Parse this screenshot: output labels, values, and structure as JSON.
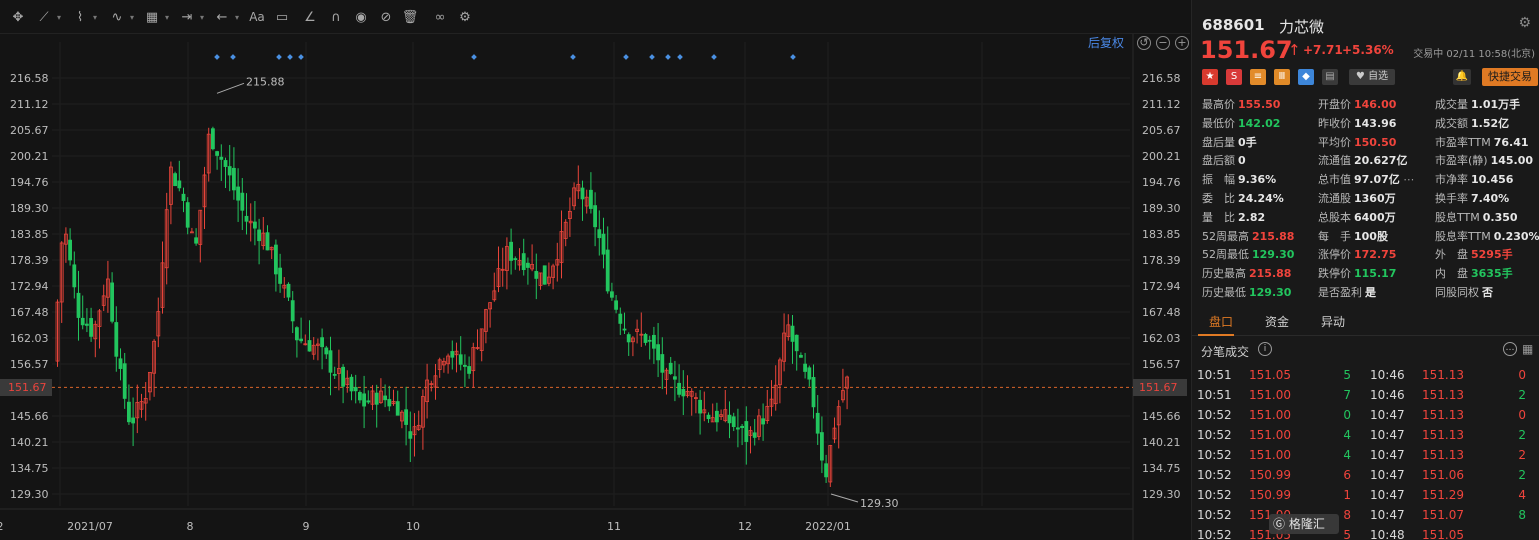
{
  "toolbar": {
    "icons": [
      "move-icon",
      "line-tool-icon",
      "polyline-icon",
      "wave-tool-icon",
      "fib-icon",
      "measure-icon",
      "arrow-icon",
      "text-icon",
      "note-icon",
      "ruler-icon",
      "magnet-icon",
      "eye-icon",
      "hide-icon",
      "trash-icon",
      "link-icon",
      "settings-icon"
    ]
  },
  "chart": {
    "reset_label": "后复权",
    "current_price": "151.67",
    "price_ticks": [
      "216.58",
      "211.12",
      "205.67",
      "200.21",
      "194.76",
      "189.30",
      "183.85",
      "178.39",
      "172.94",
      "167.48",
      "162.03",
      "156.57",
      "151.67",
      "145.66",
      "140.21",
      "134.75",
      "129.30"
    ],
    "date_ticks": [
      "2021/07",
      "8",
      "9",
      "10",
      "11",
      "12",
      "2022/01",
      "2"
    ],
    "high_label": "215.88",
    "low_label": "129.30",
    "up_color": "#e8443a",
    "down_color": "#22c55e",
    "dot_color": "#4a90e2"
  },
  "chart_data": {
    "type": "candlestick",
    "x_range": [
      "2021/07",
      "2022/02"
    ],
    "ylim": [
      129.3,
      216.58
    ],
    "annotations": [
      {
        "text": "215.88",
        "kind": "period-high"
      },
      {
        "text": "129.30",
        "kind": "period-low"
      }
    ],
    "reference_line": 151.67
  },
  "quote": {
    "code": "688601",
    "name": "力芯微",
    "price": "151.67",
    "arrow": "↑",
    "change": "+7.71",
    "change_pct": "+5.36%",
    "status": "交易中 02/11 10:58(北京)",
    "watch_label": "自选",
    "trade_label": "快捷交易",
    "stats": [
      [
        {
          "label": "最高价",
          "value": "155.50",
          "color": "red"
        },
        {
          "label": "开盘价",
          "value": "146.00",
          "color": "red"
        },
        {
          "label": "成交量",
          "value": "1.01万手",
          "color": ""
        }
      ],
      [
        {
          "label": "最低价",
          "value": "142.02",
          "color": "green"
        },
        {
          "label": "昨收价",
          "value": "143.96",
          "color": ""
        },
        {
          "label": "成交额",
          "value": "1.52亿",
          "color": ""
        }
      ],
      [
        {
          "label": "盘后量",
          "value": "0手",
          "color": ""
        },
        {
          "label": "平均价",
          "value": "150.50",
          "color": "red"
        },
        {
          "label": "市盈率TTM",
          "value": "76.41",
          "color": ""
        }
      ],
      [
        {
          "label": "盘后额",
          "value": "0",
          "color": ""
        },
        {
          "label": "流通值",
          "value": "20.627亿",
          "color": ""
        },
        {
          "label": "市盈率(静)",
          "value": "145.00",
          "color": ""
        }
      ],
      [
        {
          "label": "振　幅",
          "value": "9.36%",
          "color": ""
        },
        {
          "label": "总市值",
          "value": "97.07亿",
          "color": ""
        },
        {
          "label": "市净率",
          "value": "10.456",
          "color": ""
        }
      ],
      [
        {
          "label": "委　比",
          "value": "24.24%",
          "color": ""
        },
        {
          "label": "流通股",
          "value": "1360万",
          "color": ""
        },
        {
          "label": "换手率",
          "value": "7.40%",
          "color": ""
        }
      ],
      [
        {
          "label": "量　比",
          "value": "2.82",
          "color": ""
        },
        {
          "label": "总股本",
          "value": "6400万",
          "color": ""
        },
        {
          "label": "股息TTM",
          "value": "0.350",
          "color": ""
        }
      ],
      [
        {
          "label": "52周最高",
          "value": "215.88",
          "color": "red"
        },
        {
          "label": "每　手",
          "value": "100股",
          "color": ""
        },
        {
          "label": "股息率TTM",
          "value": "0.230%",
          "color": ""
        }
      ],
      [
        {
          "label": "52周最低",
          "value": "129.30",
          "color": "green"
        },
        {
          "label": "涨停价",
          "value": "172.75",
          "color": "red"
        },
        {
          "label": "外　盘",
          "value": "5295手",
          "color": "red"
        }
      ],
      [
        {
          "label": "历史最高",
          "value": "215.88",
          "color": "red"
        },
        {
          "label": "跌停价",
          "value": "115.17",
          "color": "green"
        },
        {
          "label": "内　盘",
          "value": "3635手",
          "color": "green"
        }
      ],
      [
        {
          "label": "历史最低",
          "value": "129.30",
          "color": "green"
        },
        {
          "label": "是否盈利",
          "value": "是",
          "color": ""
        },
        {
          "label": "同股同权",
          "value": "否",
          "color": ""
        }
      ]
    ],
    "tabs": [
      "盘口",
      "资金",
      "异动"
    ],
    "trades_title": "分笔成交",
    "trades": [
      [
        "10:51",
        "151.05",
        "5",
        "green",
        "10:46",
        "151.13",
        "0",
        "red"
      ],
      [
        "10:51",
        "151.00",
        "7",
        "green",
        "10:46",
        "151.13",
        "2",
        "green"
      ],
      [
        "10:52",
        "151.00",
        "0",
        "green",
        "10:47",
        "151.13",
        "0",
        "red"
      ],
      [
        "10:52",
        "151.00",
        "4",
        "green",
        "10:47",
        "151.13",
        "2",
        "green"
      ],
      [
        "10:52",
        "151.00",
        "4",
        "green",
        "10:47",
        "151.13",
        "2",
        "red"
      ],
      [
        "10:52",
        "150.99",
        "6",
        "red",
        "10:47",
        "151.06",
        "2",
        "green"
      ],
      [
        "10:52",
        "150.99",
        "1",
        "red",
        "10:47",
        "151.29",
        "4",
        "red"
      ],
      [
        "10:52",
        "151.00",
        "8",
        "red",
        "10:47",
        "151.07",
        "8",
        "green"
      ],
      [
        "10:52",
        "151.05",
        "5",
        "red",
        "10:48",
        "151.05",
        "",
        ""
      ]
    ],
    "watermark": "格隆汇"
  }
}
